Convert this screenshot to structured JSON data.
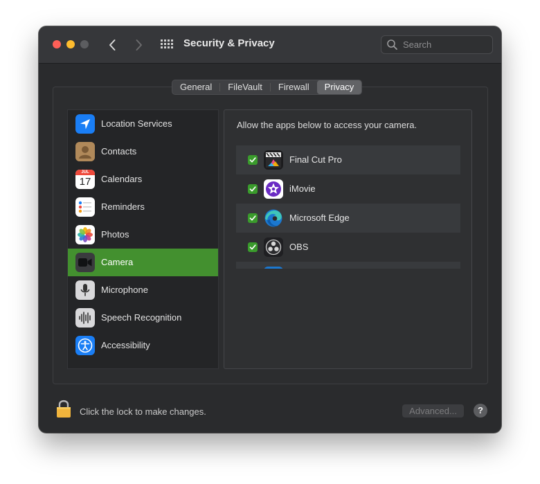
{
  "window": {
    "title": "Security & Privacy"
  },
  "search": {
    "placeholder": "Search"
  },
  "tabs": [
    "General",
    "FileVault",
    "Firewall",
    "Privacy"
  ],
  "active_tab": "Privacy",
  "sidebar": {
    "items": [
      {
        "label": "Location Services",
        "icon": "location-icon"
      },
      {
        "label": "Contacts",
        "icon": "contacts-icon"
      },
      {
        "label": "Calendars",
        "icon": "calendar-icon",
        "icon_text_top": "JUL",
        "icon_text_day": "17"
      },
      {
        "label": "Reminders",
        "icon": "reminders-icon"
      },
      {
        "label": "Photos",
        "icon": "photos-icon"
      },
      {
        "label": "Camera",
        "icon": "camera-icon",
        "selected": true
      },
      {
        "label": "Microphone",
        "icon": "microphone-icon"
      },
      {
        "label": "Speech Recognition",
        "icon": "speech-recognition-icon"
      },
      {
        "label": "Accessibility",
        "icon": "accessibility-icon"
      }
    ]
  },
  "main": {
    "description": "Allow the apps below to access your camera.",
    "apps": [
      {
        "name": "Final Cut Pro",
        "checked": true,
        "icon": "final-cut-pro-icon"
      },
      {
        "name": "iMovie",
        "checked": true,
        "icon": "imovie-icon"
      },
      {
        "name": "Microsoft Edge",
        "checked": true,
        "icon": "microsoft-edge-icon"
      },
      {
        "name": "OBS",
        "checked": true,
        "icon": "obs-icon"
      }
    ]
  },
  "footer": {
    "lock_text": "Click the lock to make changes.",
    "advanced_label": "Advanced...",
    "help_label": "?"
  },
  "colors": {
    "selection": "#43902f",
    "checkbox": "#3a9b2c",
    "close": "#fe5f57",
    "minimize": "#febc2e"
  }
}
